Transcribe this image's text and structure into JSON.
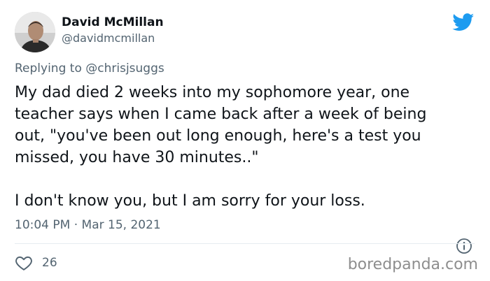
{
  "author": {
    "display_name": "David McMillan",
    "handle": "@davidmcmillan",
    "avatar": "profile-photo"
  },
  "brand": {
    "icon": "twitter-bird-icon",
    "color": "#1d9bf0"
  },
  "reply": {
    "prefix": "Replying to",
    "mention": "@chrisjsuggs"
  },
  "tweet": {
    "lines": [
      "My dad died 2 weeks into my sophomore year, one",
      "teacher says when I came back after a week of being",
      "out, \"you've been out long enough, here's a test you",
      "missed, you have 30 minutes..\"",
      "I don't know you, but I am sorry for your loss."
    ]
  },
  "meta": {
    "time": "10:04 PM",
    "separator": "·",
    "date": "Mar 15, 2021"
  },
  "actions": {
    "like_icon": "heart-icon",
    "like_count": "26",
    "info_icon": "info-icon"
  },
  "watermark": {
    "text": "boredpanda.com"
  },
  "colors": {
    "text_primary": "#0f1419",
    "text_secondary": "#536471",
    "divider": "#e6ecf0"
  }
}
